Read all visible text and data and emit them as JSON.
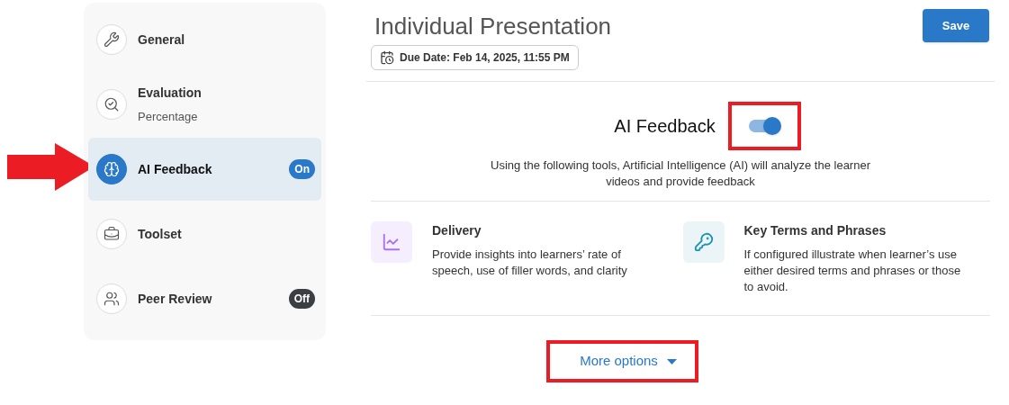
{
  "sidebar": {
    "items": [
      {
        "kind": "wrench",
        "label": "General",
        "selected": false,
        "pointed": false
      },
      {
        "kind": "evaluation",
        "label": "Evaluation",
        "subtitle": "Percentage",
        "selected": false,
        "pointed": false
      },
      {
        "kind": "brain",
        "label": "AI Feedback",
        "selected": true,
        "pointed": true,
        "badge": {
          "text": "On",
          "on": true
        }
      },
      {
        "kind": "toolbox",
        "label": "Toolset",
        "selected": false,
        "pointed": false
      },
      {
        "kind": "people",
        "label": "Peer Review",
        "selected": false,
        "pointed": false,
        "badge": {
          "text": "Off",
          "on": false
        }
      }
    ]
  },
  "header": {
    "title": "Individual Presentation",
    "save_button": "Save",
    "due_date": "Due Date: Feb 14, 2025, 11:55 PM"
  },
  "ai_feedback": {
    "title": "AI Feedback",
    "toggle": {
      "on": true,
      "highlighted": true
    },
    "description": "Using the following tools, Artificial Intelligence (AI) will analyze the learner videos and provide feedback"
  },
  "tools": [
    {
      "kind": "chart",
      "title": "Delivery",
      "description": "Provide insights into learners’ rate of speech, use of filler words, and clarity"
    },
    {
      "kind": "key",
      "title": "Key Terms and Phrases",
      "description": "If configured illustrate when learner’s use either desired terms and phrases or those to avoid."
    }
  ],
  "more_options": {
    "label": "More options",
    "highlighted": true
  }
}
